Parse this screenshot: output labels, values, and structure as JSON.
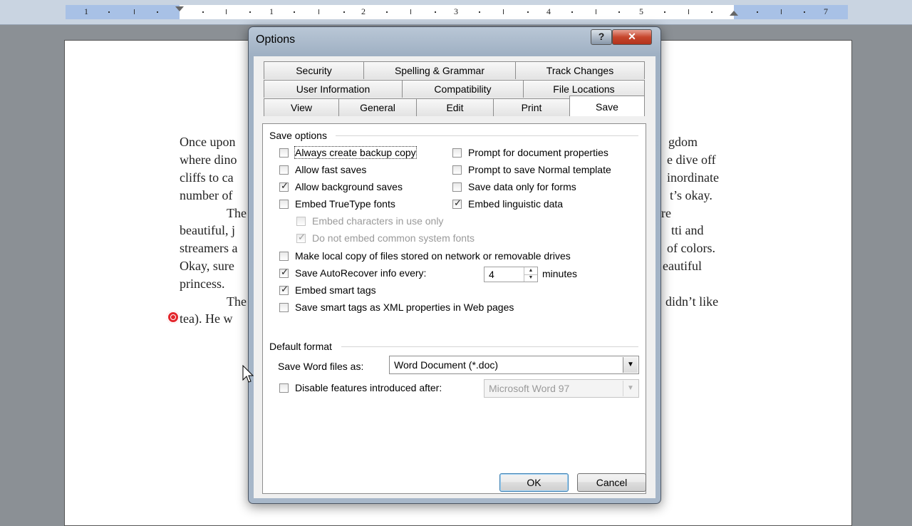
{
  "ruler": {
    "numbers": [
      "1",
      "1",
      "2",
      "3",
      "4",
      "5",
      "7"
    ]
  },
  "document": {
    "lines": [
      {
        "left": "Once upon",
        "right": "gdom"
      },
      {
        "left": "where dino",
        "right": "e dive off"
      },
      {
        "left": "cliffs to ca",
        "right": "inordinate"
      },
      {
        "left": "number of",
        "right": "t’s okay."
      },
      {
        "left": "The",
        "right": "re"
      },
      {
        "left": "beautiful, j",
        "right": "tti and"
      },
      {
        "left": "streamers a",
        "right": "of colors."
      },
      {
        "left": "Okay, sure",
        "right": "eautiful"
      },
      {
        "left": "princess.",
        "right": ""
      },
      {
        "left": "The",
        "right": "didn’t like"
      },
      {
        "left": "tea).  He w",
        "right": ""
      }
    ]
  },
  "dialog": {
    "title": "Options",
    "help_glyph": "?",
    "close_glyph": "✕",
    "tabs_row1": [
      "Security",
      "Spelling & Grammar",
      "Track Changes"
    ],
    "tabs_row2": [
      "User Information",
      "Compatibility",
      "File Locations"
    ],
    "tabs_row3": [
      "View",
      "General",
      "Edit",
      "Print",
      "Save"
    ],
    "active_tab": "Save",
    "save_options": {
      "heading": "Save options",
      "left": [
        {
          "label": "Always create backup copy",
          "checked": false
        },
        {
          "label": "Allow fast saves",
          "checked": false
        },
        {
          "label": "Allow background saves",
          "checked": true
        },
        {
          "label": "Embed TrueType fonts",
          "checked": false
        },
        {
          "label": "Embed characters in use only",
          "checked": false,
          "disabled": true
        },
        {
          "label": "Do not embed common system fonts",
          "checked": true,
          "disabled": true
        }
      ],
      "right": [
        {
          "label": "Prompt for document properties",
          "checked": false
        },
        {
          "label": "Prompt to save Normal template",
          "checked": false
        },
        {
          "label": "Save data only for forms",
          "checked": false
        },
        {
          "label": "Embed linguistic data",
          "checked": true
        }
      ],
      "local_copy": {
        "label": "Make local copy of files stored on network or removable drives",
        "checked": false
      },
      "autorecover": {
        "label": "Save AutoRecover info every:",
        "checked": true,
        "value": "4",
        "unit": "minutes"
      },
      "smart_tags": {
        "label": "Embed smart tags",
        "checked": true
      },
      "smart_tags_xml": {
        "label": "Save smart tags as XML properties in Web pages",
        "checked": false
      }
    },
    "default_format": {
      "heading": "Default format",
      "save_as_label": "Save Word files as:",
      "save_as_value": "Word Document (*.doc)",
      "disable_label": "Disable features introduced after:",
      "disable_checked": false,
      "disable_value": "Microsoft Word 97"
    },
    "ok_label": "OK",
    "cancel_label": "Cancel"
  }
}
